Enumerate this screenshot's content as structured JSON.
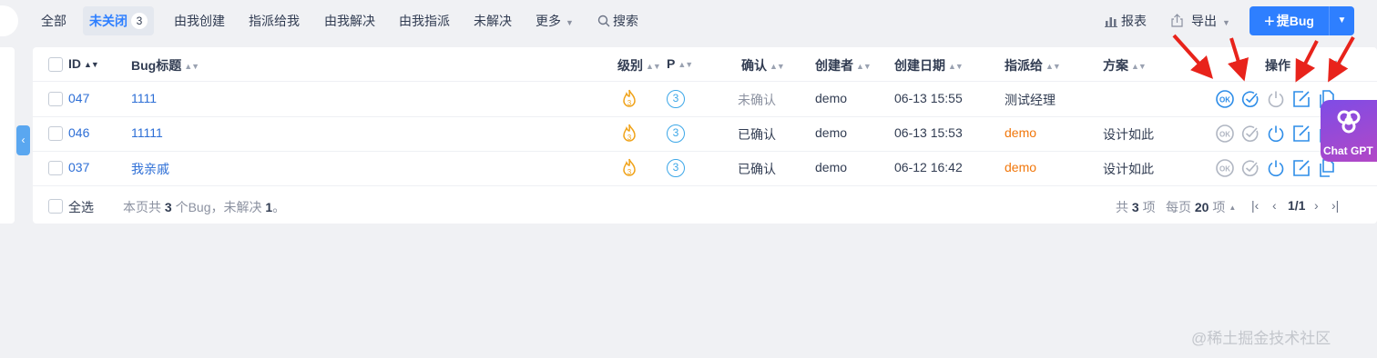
{
  "nav": {
    "tabs": [
      {
        "label": "全部"
      },
      {
        "label": "未关闭",
        "count": "3"
      },
      {
        "label": "由我创建"
      },
      {
        "label": "指派给我"
      },
      {
        "label": "由我解决"
      },
      {
        "label": "由我指派"
      },
      {
        "label": "未解决"
      },
      {
        "label": "更多"
      }
    ],
    "search_label": "搜索",
    "report_label": "报表",
    "export_label": "导出",
    "create_label": "提Bug"
  },
  "table": {
    "headers": {
      "id": "ID",
      "title": "Bug标题",
      "severity": "级别",
      "priority": "P",
      "confirmed": "确认",
      "creator": "创建者",
      "created_date": "创建日期",
      "assigned_to": "指派给",
      "resolution": "方案",
      "actions": "操作"
    },
    "rows": [
      {
        "id": "047",
        "title": "1111",
        "priority": "3",
        "confirmed": "未确认",
        "creator": "demo",
        "created_date": "06-13 15:55",
        "assigned_to": "测试经理",
        "resolution": ""
      },
      {
        "id": "046",
        "title": "11111",
        "priority": "3",
        "confirmed": "已确认",
        "creator": "demo",
        "created_date": "06-13 15:53",
        "assigned_to": "demo",
        "resolution": "设计如此"
      },
      {
        "id": "037",
        "title": "我亲戚",
        "priority": "3",
        "confirmed": "已确认",
        "creator": "demo",
        "created_date": "06-12 16:42",
        "assigned_to": "demo",
        "resolution": "设计如此"
      }
    ],
    "action_icons": [
      "ok-confirm-icon",
      "check-resolve-icon",
      "power-close-icon",
      "edit-icon",
      "copy-icon"
    ]
  },
  "footer": {
    "select_all_label": "全选",
    "summary_prefix": "本页共",
    "summary_total": "3",
    "summary_mid": "个Bug，未解决",
    "summary_unresolved": "1",
    "summary_suffix": "。",
    "total_prefix": "共",
    "total_count": "3",
    "total_suffix": "项",
    "per_page_prefix": "每页",
    "per_page": "20",
    "per_page_suffix": "项",
    "page": "1/1"
  },
  "overlay": {
    "chatgpt_label": "Chat GPT",
    "watermark": "@稀土掘金技术社区"
  },
  "colors": {
    "primary": "#2e7fff",
    "link": "#2e6fd6",
    "orange": "#f1770b",
    "severity_flame": "#f0a31a",
    "priority_ring": "#3ca7e8",
    "arrow": "#e8231b"
  }
}
